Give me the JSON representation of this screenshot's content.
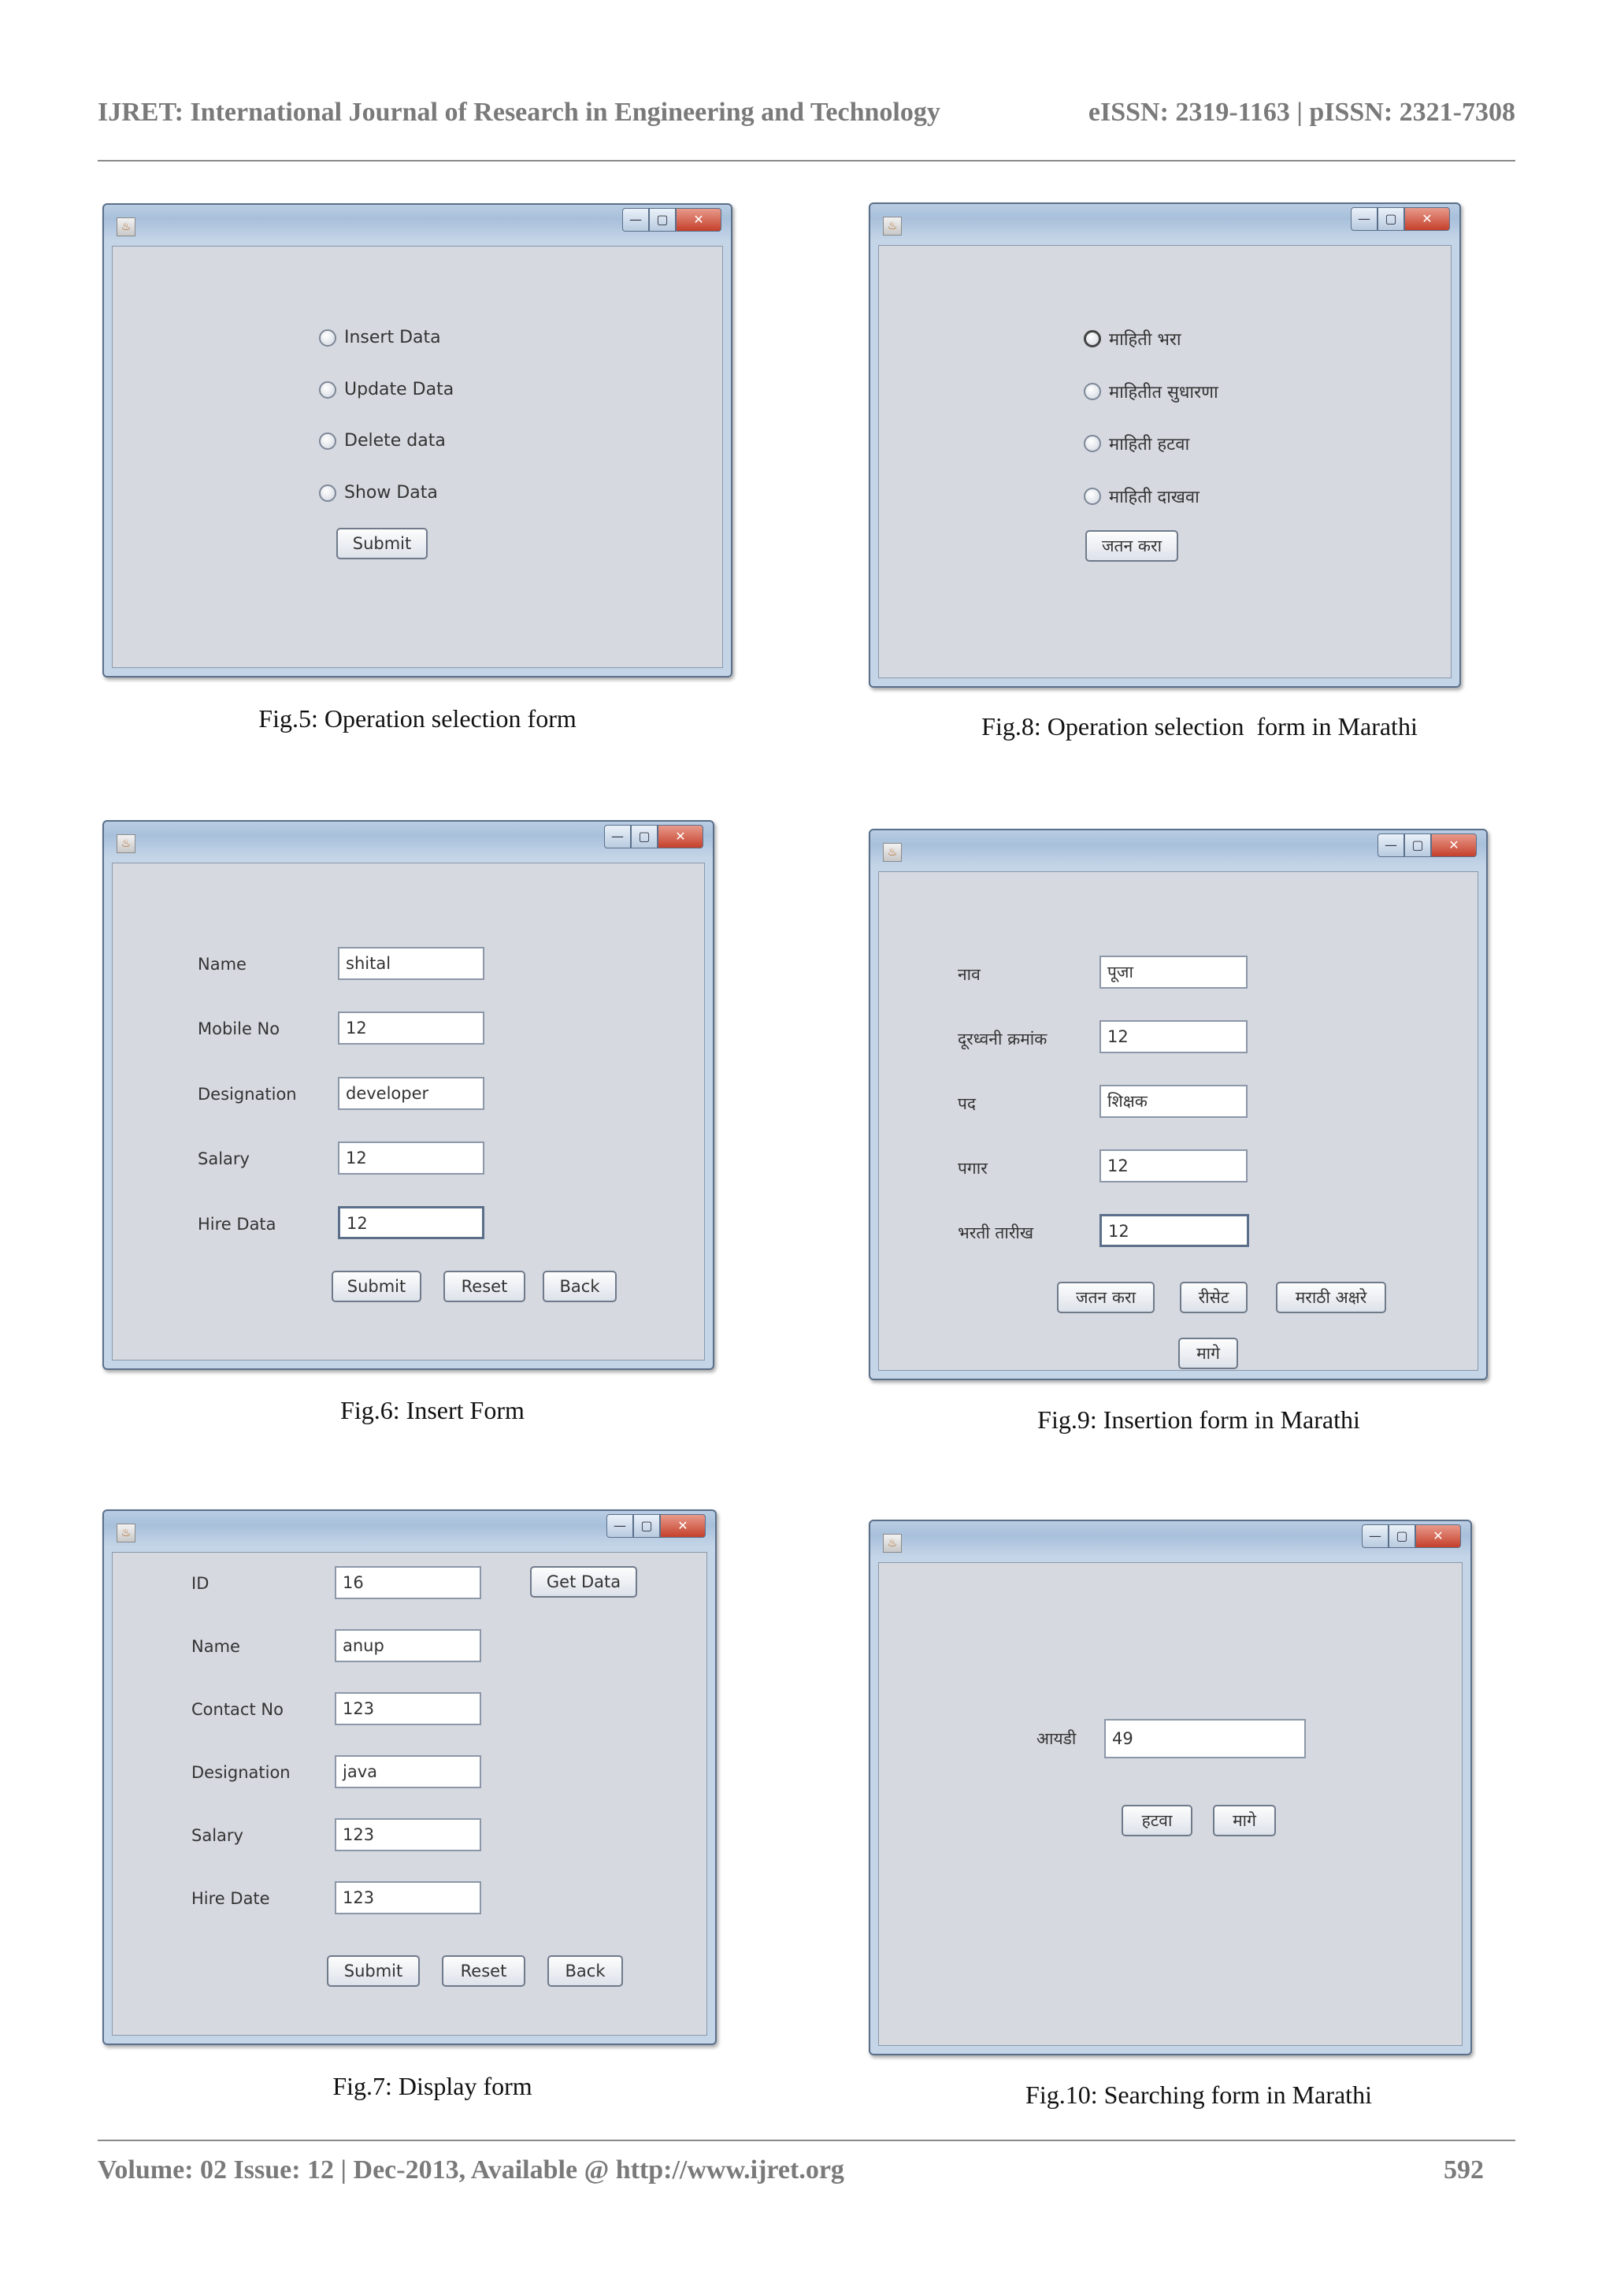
{
  "header": {
    "journal": "IJRET: International Journal of Research in Engineering and Technology",
    "issn": "eISSN: 2319-1163 | pISSN: 2321-7308"
  },
  "footer": {
    "volume": "Volume: 02 Issue: 12 | Dec-2013, Available @ http://www.ijret.org",
    "page": "592"
  },
  "window_controls": {
    "minimize": "—",
    "maximize": "▢",
    "close": "✕"
  },
  "app_icon_glyph": "♨",
  "figures": {
    "fig5": {
      "caption": "Fig.5: Operation selection form",
      "options": [
        "Insert Data",
        "Update Data",
        "Delete data",
        "Show Data"
      ],
      "submit": "Submit"
    },
    "fig8": {
      "caption": "Fig.8: Operation selection  form in Marathi",
      "options": [
        "माहिती भरा",
        "माहितीत सुधारणा",
        "माहिती हटवा",
        "माहिती दाखवा"
      ],
      "submit": "जतन करा"
    },
    "fig6": {
      "caption": "Fig.6: Insert Form",
      "labels": [
        "Name",
        "Mobile No",
        "Designation",
        "Salary",
        "Hire Data"
      ],
      "values": [
        "shital",
        "12",
        "developer",
        "12",
        "12"
      ],
      "buttons": [
        "Submit",
        "Reset",
        "Back"
      ]
    },
    "fig9": {
      "caption": "Fig.9: Insertion form in Marathi",
      "labels": [
        "नाव",
        "दूरध्वनी क्रमांक",
        "पद",
        "पगार",
        "भरती तारीख"
      ],
      "values": [
        "पूजा",
        "12",
        "शिक्षक",
        "12",
        "12"
      ],
      "buttons": [
        "जतन करा",
        "रीसेट",
        "मराठी अक्षरे"
      ],
      "back": "मागे"
    },
    "fig7": {
      "caption": "Fig.7: Display form",
      "labels": [
        "ID",
        "Name",
        "Contact No",
        "Designation",
        "Salary",
        "Hire Date"
      ],
      "values": [
        "16",
        "anup",
        "123",
        "java",
        "123",
        "123"
      ],
      "get_data": "Get Data",
      "buttons": [
        "Submit",
        "Reset",
        "Back"
      ]
    },
    "fig10": {
      "caption": "Fig.10: Searching form in Marathi",
      "label": "आयडी",
      "value": "49",
      "buttons": [
        "हटवा",
        "मागे"
      ]
    }
  }
}
